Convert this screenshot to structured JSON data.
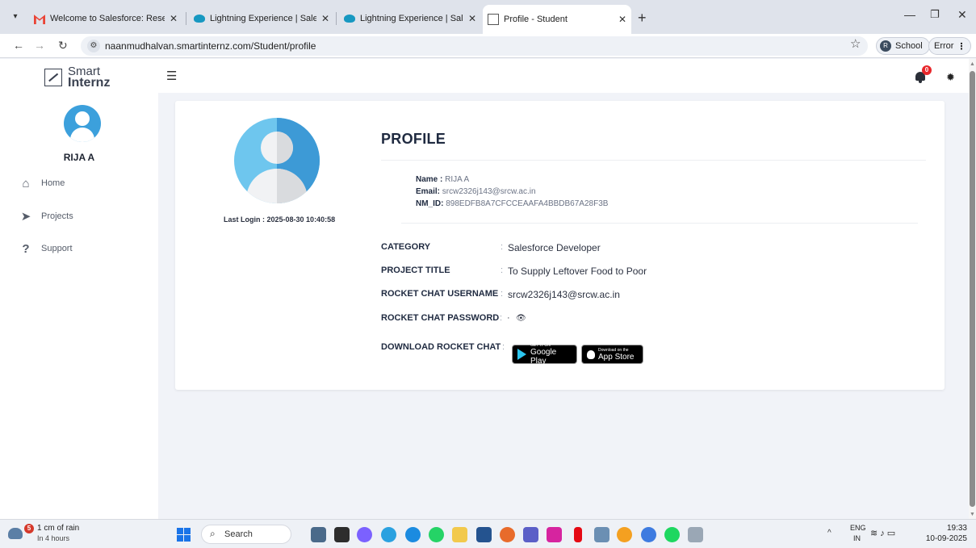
{
  "browser": {
    "tabs": [
      {
        "title": "Welcome to Salesforce: Reset y",
        "icon": "gmail-icon"
      },
      {
        "title": "Lightning Experience | Salesforc",
        "icon": "salesforce-cloud-icon"
      },
      {
        "title": "Lightning Experience | Salesforc",
        "icon": "salesforce-cloud-icon"
      },
      {
        "title": "Profile - Student",
        "icon": "smartinternz-icon",
        "active": true
      }
    ],
    "url": "naanmudhalvan.smartinternz.com/Student/profile",
    "profile_chip": {
      "initial": "R",
      "label": "School"
    },
    "error_chip": "Error"
  },
  "app": {
    "logo_line1": "Smart",
    "logo_line2": "Internz",
    "notification_count": "0"
  },
  "sidebar": {
    "user_name": "RIJA A",
    "items": [
      {
        "label": "Home",
        "icon": "home-icon"
      },
      {
        "label": "Projects",
        "icon": "paper-plane-icon"
      },
      {
        "label": "Support",
        "icon": "question-icon"
      }
    ]
  },
  "profile": {
    "title": "PROFILE",
    "last_login_label": "Last Login :",
    "last_login_value": "2025-08-30 10:40:58",
    "name_label": "Name :",
    "name_value": "RIJA A",
    "email_label": "Email:",
    "email_value": "srcw2326j143@srcw.ac.in",
    "nmid_label": "NM_ID:",
    "nmid_value": "898EDFB8A7CFCCEAAFA4BBDB67A28F3B",
    "fields": [
      {
        "label": "CATEGORY",
        "value": "Salesforce Developer"
      },
      {
        "label": "PROJECT TITLE",
        "value": "To Supply Leftover Food to Poor"
      },
      {
        "label": "ROCKET CHAT USERNAME",
        "value": "srcw2326j143@srcw.ac.in"
      }
    ],
    "password_label": "ROCKET CHAT PASSWORD",
    "password_mask": "·",
    "download_label": "DOWNLOAD ROCKET CHAT",
    "google_play_small": "GET IT ON",
    "google_play_big": "Google Play",
    "app_store_small": "Download on the",
    "app_store_big": "App Store"
  },
  "taskbar": {
    "weather_badge": "5",
    "weather_line1": "1 cm of rain",
    "weather_line2": "In 4 hours",
    "search_label": "Search",
    "lang1": "ENG",
    "lang2": "IN",
    "time": "19:33",
    "date": "10-09-2025"
  },
  "colors": {
    "accent_blue": "#3ca0dc",
    "page_bg": "#f1f3f8",
    "badge_red": "#e8262a"
  }
}
